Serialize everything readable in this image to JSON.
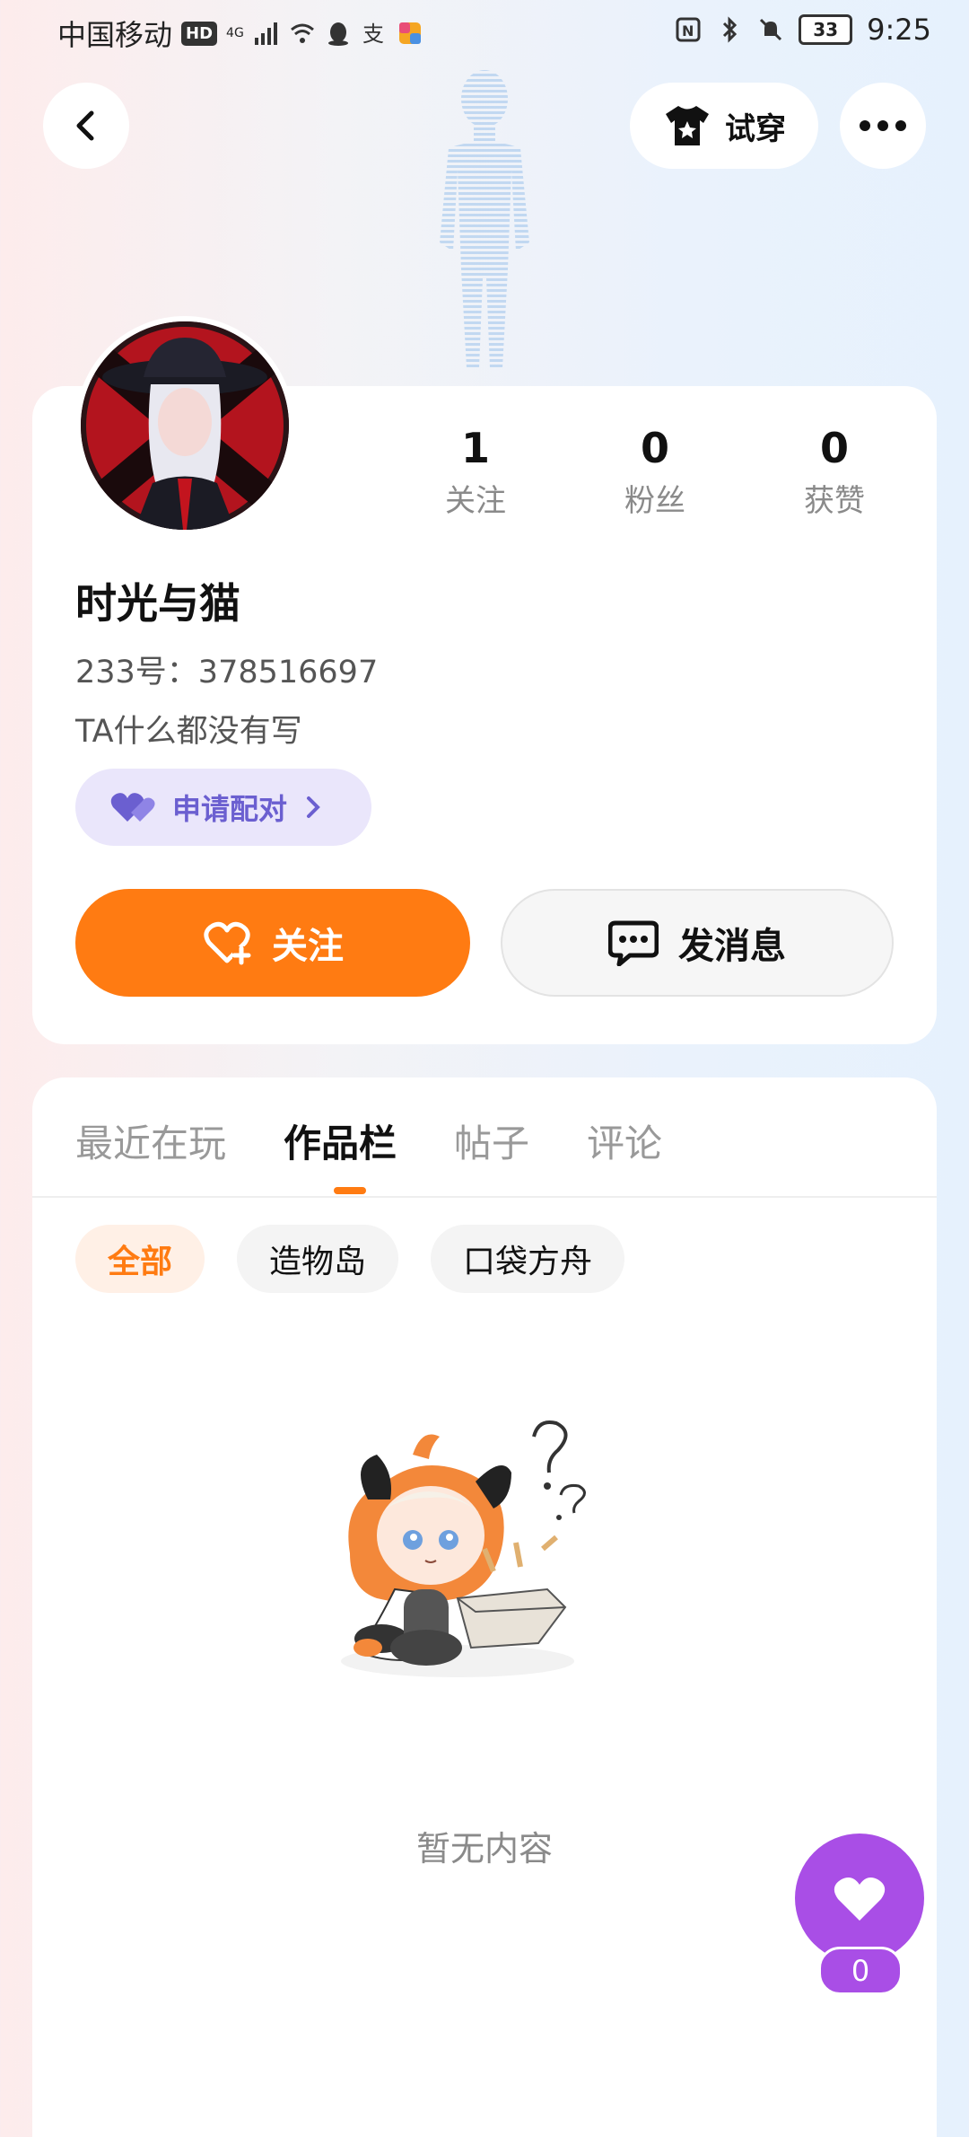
{
  "status_bar": {
    "carrier": "中国移动",
    "hd": "HD",
    "network": "4G",
    "battery": "33",
    "time": "9:25"
  },
  "header": {
    "try_on_label": "试穿"
  },
  "profile": {
    "stats": [
      {
        "value": "1",
        "label": "关注"
      },
      {
        "value": "0",
        "label": "粉丝"
      },
      {
        "value": "0",
        "label": "获赞"
      }
    ],
    "username": "时光与猫",
    "id_line": "233号：378516697",
    "bio": "TA什么都没有写",
    "pair_label": "申请配对",
    "follow_label": "关注",
    "message_label": "发消息"
  },
  "tabs": [
    {
      "label": "最近在玩",
      "active": false
    },
    {
      "label": "作品栏",
      "active": true
    },
    {
      "label": "帖子",
      "active": false
    },
    {
      "label": "评论",
      "active": false
    }
  ],
  "filters": [
    {
      "label": "全部",
      "active": true
    },
    {
      "label": "造物岛",
      "active": false
    },
    {
      "label": "口袋方舟",
      "active": false
    }
  ],
  "empty_state": {
    "text": "暂无内容"
  },
  "like_fab": {
    "count": "0"
  },
  "colors": {
    "accent": "#ff7b12",
    "pair": "#6b5fd0",
    "like": "#a94ee6"
  }
}
